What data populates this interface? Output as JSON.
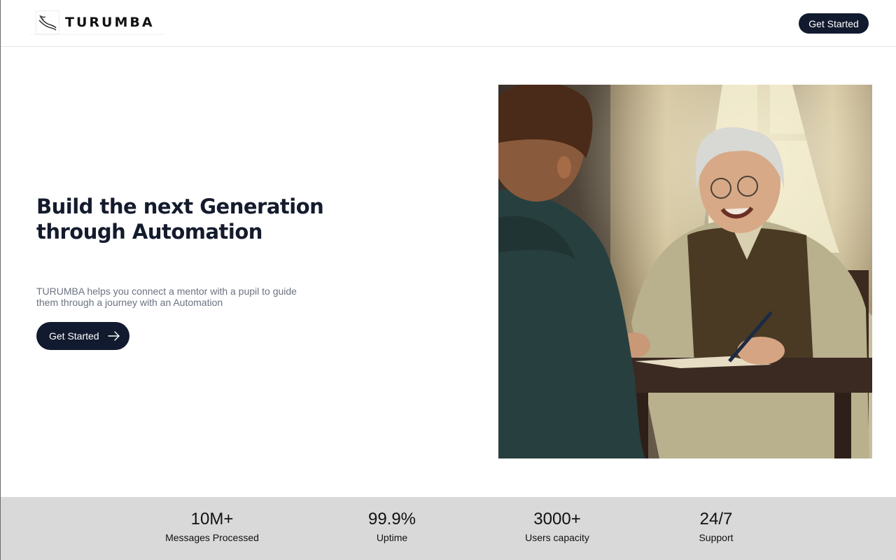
{
  "brand": {
    "name": "TURUMBA",
    "logo_icon": "hand-feather-logo"
  },
  "header": {
    "cta_label": "Get Started"
  },
  "hero": {
    "title": "Build the next Generation through Automation",
    "subtitle": "TURUMBA helps you connect a mentor with a pupil to guide them through a journey with an Automation",
    "cta_label": "Get Started",
    "cta_icon": "arrow-right-icon"
  },
  "stats": [
    {
      "value": "10M+",
      "label": "Messages Processed"
    },
    {
      "value": "99.9%",
      "label": "Uptime"
    },
    {
      "value": "3000+",
      "label": "Users capacity"
    },
    {
      "value": "24/7",
      "label": "Support"
    }
  ],
  "colors": {
    "primary_dark": "#111a2e",
    "stats_band": "#d9d9d9",
    "muted_text": "#6b7280"
  }
}
